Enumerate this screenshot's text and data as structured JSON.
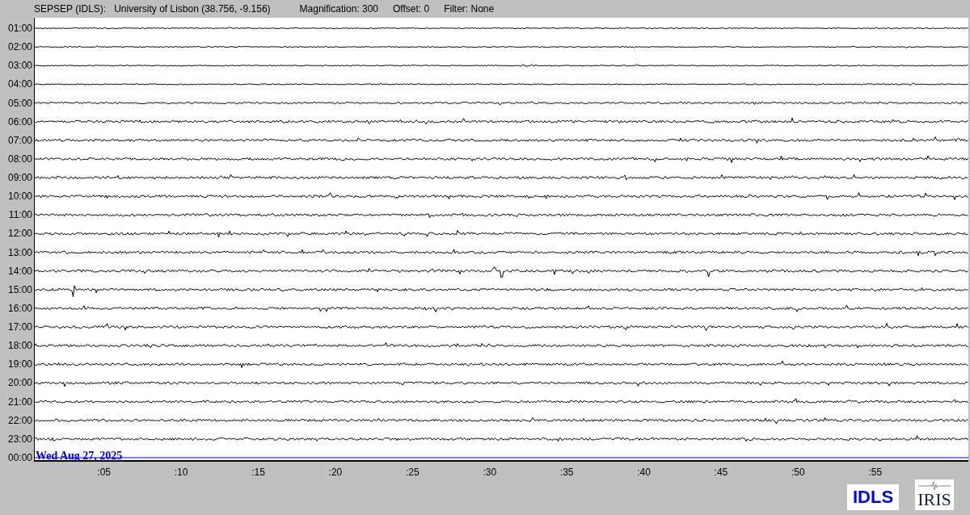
{
  "header": {
    "station": "SEPSEP (IDLS):",
    "location": "University of Lisbon (38.756, -9.156)",
    "magnification": "Magnification: 300",
    "offset": "Offset: 0",
    "filter": "Filter: None"
  },
  "hour_labels": [
    "01:00",
    "02:00",
    "03:00",
    "04:00",
    "05:00",
    "06:00",
    "07:00",
    "08:00",
    "09:00",
    "10:00",
    "11:00",
    "12:00",
    "13:00",
    "14:00",
    "15:00",
    "16:00",
    "17:00",
    "18:00",
    "19:00",
    "20:00",
    "21:00",
    "22:00",
    "23:00",
    "00:00"
  ],
  "date_label": "Wed Aug 27, 2025",
  "x_ticks": [
    ":05",
    ":10",
    ":15",
    ":20",
    ":25",
    ":30",
    ":35",
    ":40",
    ":45",
    ":50",
    ":55"
  ],
  "logos": {
    "network": "IDLS",
    "consortium": "IRIS"
  }
}
